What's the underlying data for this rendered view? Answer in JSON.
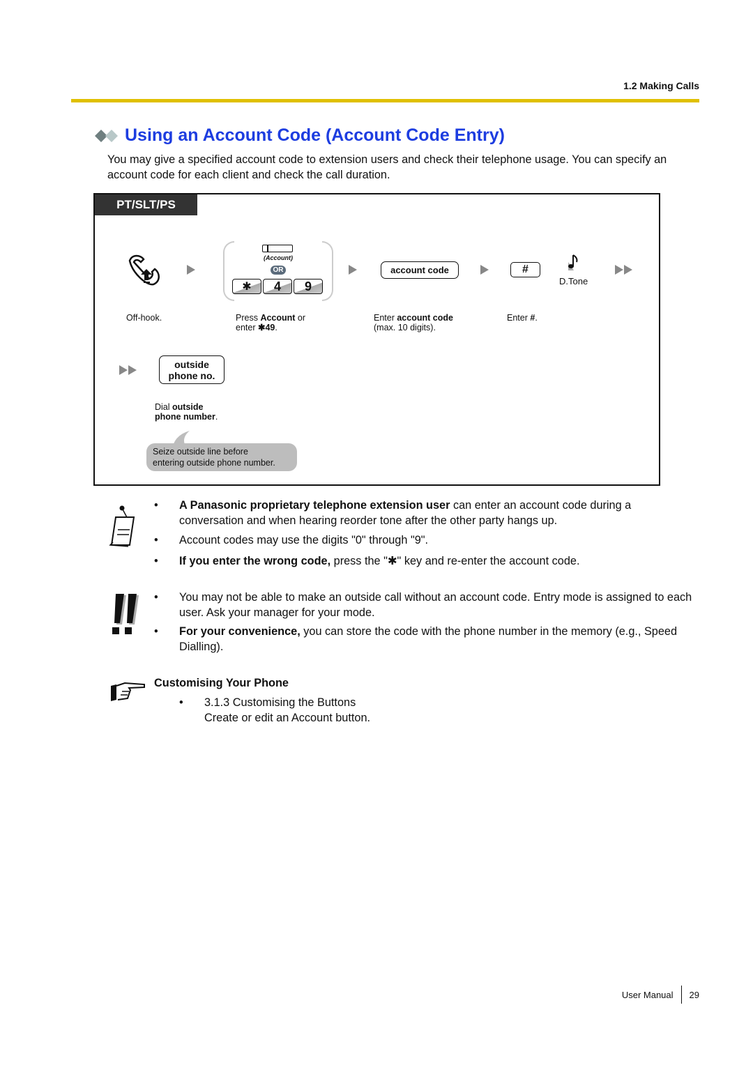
{
  "header": {
    "section": "1.2 Making Calls"
  },
  "title": "Using an Account Code (Account Code Entry)",
  "intro": "You may give a specified account code to extension users and check their telephone usage. You can specify an account code for each client and check the call duration.",
  "colors": {
    "title": "#1d3de0",
    "rule": "#e0c000",
    "tab_bg": "#333333",
    "bubble": "#bdbdbd"
  },
  "procedure": {
    "tab": "PT/SLT/PS",
    "steps": [
      {
        "icon": "off-hook-icon",
        "caption": "Off-hook."
      },
      {
        "button_label": "(Account)",
        "or_label": "OR",
        "keys": [
          "✱",
          "4",
          "9"
        ],
        "caption_pre": "Press ",
        "caption_bold": "Account",
        "caption_mid": " or",
        "caption_line2_pre": "enter ",
        "caption_line2_bold": "✱49",
        "caption_line2_post": "."
      },
      {
        "pill": "account code",
        "caption_pre": "Enter ",
        "caption_bold": "account code",
        "caption_line2": "(max. 10 digits)."
      },
      {
        "key": "#",
        "caption_pre": "Enter ",
        "caption_bold": "#",
        "caption_post": ".",
        "tone": "D.Tone"
      },
      {
        "pill_line1": "outside",
        "pill_line2": "phone no.",
        "caption_pre": "Dial ",
        "caption_bold1": "outside",
        "caption_bold2": "phone number",
        "caption_post": "."
      }
    ],
    "bubble_line1": "Seize outside line before",
    "bubble_line2": "entering outside phone number."
  },
  "notes": [
    {
      "bold": "A Panasonic proprietary telephone extension user",
      "text": " can enter an account code during a conversation and when hearing reorder tone after the other party hangs up."
    },
    {
      "bold": "",
      "text": "Account codes may use the digits \"0\" through \"9\"."
    },
    {
      "bold": "If you enter the wrong code,",
      "text": " press the \"✱\" key and re-enter the account code."
    }
  ],
  "warnings": [
    {
      "bold": "",
      "text": "You may not be able to make an outside call without an account code. Entry mode is assigned to each user. Ask your manager for your mode."
    },
    {
      "bold": "For your convenience,",
      "text": " you can store the code with the phone number in the memory (e.g., Speed Dialling)."
    }
  ],
  "reference": {
    "heading": "Customising Your Phone",
    "item_line1": "3.1.3 Customising the Buttons",
    "item_line2": "Create or edit an Account button."
  },
  "footer": {
    "label": "User Manual",
    "page": "29"
  },
  "bullet": "•"
}
